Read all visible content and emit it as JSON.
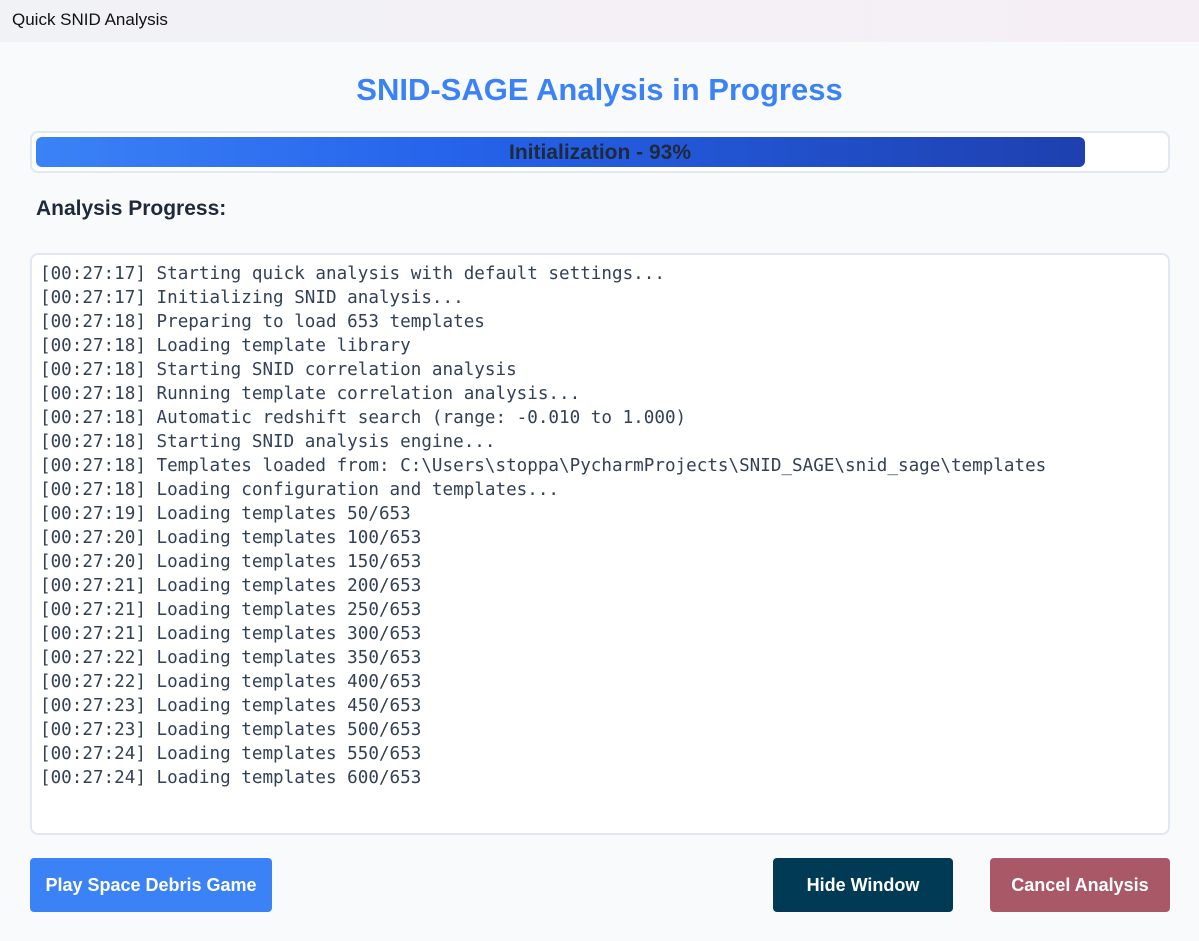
{
  "window": {
    "title": "Quick SNID Analysis"
  },
  "header": {
    "title": "SNID-SAGE Analysis in Progress"
  },
  "progress": {
    "label": "Initialization - 93%",
    "percent": 93,
    "fill_color_start": "#3b82f6",
    "fill_color_end": "#1e40af"
  },
  "log": {
    "heading": "Analysis Progress:",
    "lines": [
      "[00:27:17] Starting quick analysis with default settings...",
      "[00:27:17] Initializing SNID analysis...",
      "[00:27:18] Preparing to load 653 templates",
      "[00:27:18] Loading template library",
      "[00:27:18] Starting SNID correlation analysis",
      "[00:27:18] Running template correlation analysis...",
      "[00:27:18] Automatic redshift search (range: -0.010 to 1.000)",
      "[00:27:18] Starting SNID analysis engine...",
      "[00:27:18] Templates loaded from: C:\\Users\\stoppa\\PycharmProjects\\SNID_SAGE\\snid_sage\\templates",
      "[00:27:18] Loading configuration and templates...",
      "[00:27:19] Loading templates 50/653",
      "[00:27:20] Loading templates 100/653",
      "[00:27:20] Loading templates 150/653",
      "[00:27:21] Loading templates 200/653",
      "[00:27:21] Loading templates 250/653",
      "[00:27:21] Loading templates 300/653",
      "[00:27:22] Loading templates 350/653",
      "[00:27:22] Loading templates 400/653",
      "[00:27:23] Loading templates 450/653",
      "[00:27:23] Loading templates 500/653",
      "[00:27:24] Loading templates 550/653",
      "[00:27:24] Loading templates 600/653"
    ]
  },
  "buttons": {
    "game_label": "Play Space Debris Game",
    "hide_label": "Hide Window",
    "cancel_label": "Cancel Analysis",
    "game_color": "#3b82f6",
    "hide_color": "#003a54",
    "cancel_color": "#a85866"
  }
}
